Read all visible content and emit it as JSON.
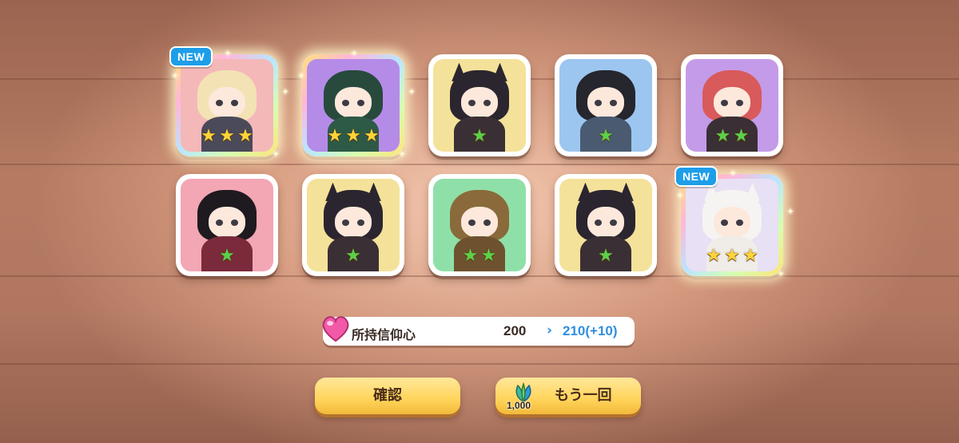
{
  "cards": [
    {
      "id": "c1",
      "new_badge": "NEW",
      "stars": 3,
      "star_color": "#ffd43a",
      "bg": "#f4b8b8",
      "hair": "#f3e2b4",
      "outfit": "#4a4a5a",
      "glow": true,
      "ears": false,
      "rainbow": true
    },
    {
      "id": "c2",
      "new_badge": "",
      "stars": 3,
      "star_color": "#ffd43a",
      "bg": "#b58be8",
      "hair": "#274a3d",
      "outfit": "#2d5a46",
      "glow": true,
      "ears": false,
      "rainbow": true
    },
    {
      "id": "c3",
      "new_badge": "",
      "stars": 1,
      "star_color": "#5bd14a",
      "bg": "#f4e29a",
      "hair": "#2b2530",
      "outfit": "#3a2f34",
      "glow": false,
      "ears": true,
      "rainbow": false
    },
    {
      "id": "c4",
      "new_badge": "",
      "stars": 1,
      "star_color": "#5bd14a",
      "bg": "#9cc6f0",
      "hair": "#26262e",
      "outfit": "#4a5a70",
      "glow": false,
      "ears": false,
      "rainbow": false
    },
    {
      "id": "c5",
      "new_badge": "",
      "stars": 2,
      "star_color": "#5bd14a",
      "bg": "#c49be8",
      "hair": "#d85a5a",
      "outfit": "#3a2f34",
      "glow": false,
      "ears": false,
      "rainbow": false
    },
    {
      "id": "c6",
      "new_badge": "",
      "stars": 1,
      "star_color": "#5bd14a",
      "bg": "#f3a6b4",
      "hair": "#1f1a1f",
      "outfit": "#7a2a3a",
      "glow": false,
      "ears": false,
      "rainbow": false
    },
    {
      "id": "c7",
      "new_badge": "",
      "stars": 1,
      "star_color": "#5bd14a",
      "bg": "#f4e29a",
      "hair": "#2b2530",
      "outfit": "#3a2f34",
      "glow": false,
      "ears": true,
      "rainbow": false
    },
    {
      "id": "c8",
      "new_badge": "",
      "stars": 2,
      "star_color": "#5bd14a",
      "bg": "#8fe0a8",
      "hair": "#8a6a3a",
      "outfit": "#6e5230",
      "glow": false,
      "ears": false,
      "rainbow": false
    },
    {
      "id": "c9",
      "new_badge": "",
      "stars": 1,
      "star_color": "#5bd14a",
      "bg": "#f4e29a",
      "hair": "#2b2530",
      "outfit": "#3a2f34",
      "glow": false,
      "ears": true,
      "rainbow": false
    },
    {
      "id": "c10",
      "new_badge": "NEW",
      "stars": 3,
      "star_color": "#ffd43a",
      "bg": "#e8e0f4",
      "hair": "#f6f4f2",
      "outfit": "#f0ece8",
      "glow": true,
      "ears": true,
      "rainbow": true
    }
  ],
  "faith": {
    "label": "所持信仰心",
    "current": "200",
    "arrow": "›",
    "next": "210(+10)"
  },
  "buttons": {
    "confirm": "確認",
    "again": "もう一回",
    "again_cost": "1,000"
  },
  "colors": {
    "accent_blue": "#2f8fe0",
    "button_yellow": "#ffd45a",
    "new_badge": "#1e9ee8"
  }
}
